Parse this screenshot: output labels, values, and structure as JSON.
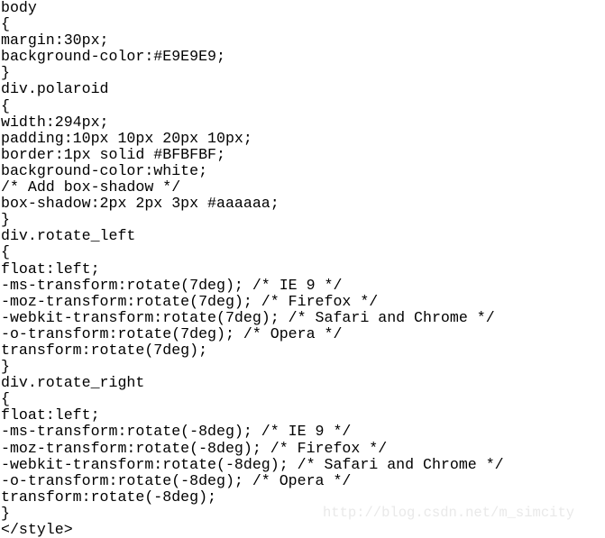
{
  "document": {
    "type": "code-listing",
    "language": "css",
    "background_color": "#ffffff",
    "text_color": "#000000",
    "lines": [
      "body",
      "{",
      "margin:30px;",
      "background-color:#E9E9E9;",
      "}",
      "div.polaroid",
      "{",
      "width:294px;",
      "padding:10px 10px 20px 10px;",
      "border:1px solid #BFBFBF;",
      "background-color:white;",
      "/* Add box-shadow */",
      "box-shadow:2px 2px 3px #aaaaaa;",
      "}",
      "div.rotate_left",
      "{",
      "float:left;",
      "-ms-transform:rotate(7deg); /* IE 9 */",
      "-moz-transform:rotate(7deg); /* Firefox */",
      "-webkit-transform:rotate(7deg); /* Safari and Chrome */",
      "-o-transform:rotate(7deg); /* Opera */",
      "transform:rotate(7deg);",
      "}",
      "div.rotate_right",
      "{",
      "float:left;",
      "-ms-transform:rotate(-8deg); /* IE 9 */",
      "-moz-transform:rotate(-8deg); /* Firefox */",
      "-webkit-transform:rotate(-8deg); /* Safari and Chrome */",
      "-o-transform:rotate(-8deg); /* Opera */",
      "transform:rotate(-8deg);",
      "}",
      "</style>"
    ]
  },
  "watermark": {
    "text": "http://blog.csdn.net/m_simcity",
    "color": "#e9e9e9"
  }
}
